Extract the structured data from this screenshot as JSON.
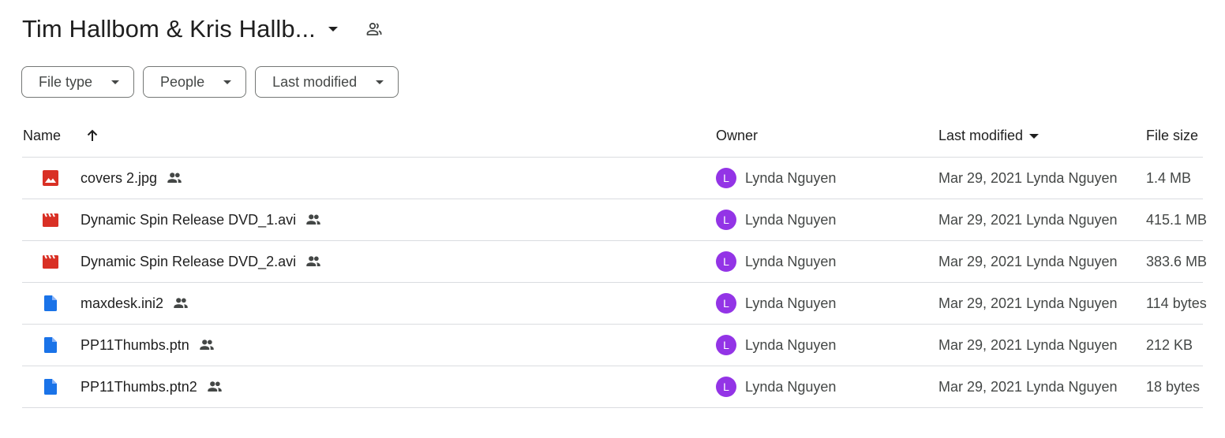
{
  "header": {
    "folder_title": "Tim Hallbom & Kris Hallb..."
  },
  "filters": [
    {
      "label": "File type"
    },
    {
      "label": "People"
    },
    {
      "label": "Last modified"
    }
  ],
  "columns": {
    "name": "Name",
    "owner": "Owner",
    "last_modified": "Last modified",
    "file_size": "File size"
  },
  "colors": {
    "image_icon": "#d93025",
    "video_icon": "#d93025",
    "doc_icon": "#1a73e8",
    "avatar": "#9334e6"
  },
  "rows": [
    {
      "name": "covers 2.jpg",
      "icon": "image-icon",
      "avatar_letter": "L",
      "owner": "Lynda Nguyen",
      "modified": "Mar 29, 2021 Lynda Nguyen",
      "size": "1.4 MB"
    },
    {
      "name": "Dynamic Spin Release DVD_1.avi",
      "icon": "video-icon",
      "avatar_letter": "L",
      "owner": "Lynda Nguyen",
      "modified": "Mar 29, 2021 Lynda Nguyen",
      "size": "415.1 MB"
    },
    {
      "name": "Dynamic Spin Release DVD_2.avi",
      "icon": "video-icon",
      "avatar_letter": "L",
      "owner": "Lynda Nguyen",
      "modified": "Mar 29, 2021 Lynda Nguyen",
      "size": "383.6 MB"
    },
    {
      "name": "maxdesk.ini2",
      "icon": "file-icon",
      "avatar_letter": "L",
      "owner": "Lynda Nguyen",
      "modified": "Mar 29, 2021 Lynda Nguyen",
      "size": "114 bytes"
    },
    {
      "name": "PP11Thumbs.ptn",
      "icon": "file-icon",
      "avatar_letter": "L",
      "owner": "Lynda Nguyen",
      "modified": "Mar 29, 2021 Lynda Nguyen",
      "size": "212 KB"
    },
    {
      "name": "PP11Thumbs.ptn2",
      "icon": "file-icon",
      "avatar_letter": "L",
      "owner": "Lynda Nguyen",
      "modified": "Mar 29, 2021 Lynda Nguyen",
      "size": "18 bytes"
    }
  ]
}
